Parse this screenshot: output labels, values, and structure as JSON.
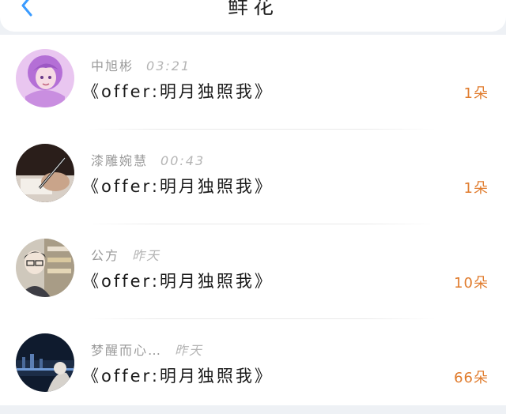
{
  "header": {
    "title": "鲜花",
    "back_icon": "chevron-left-icon",
    "accent_color": "#3a9bff"
  },
  "records": [
    {
      "name": "中旭彬",
      "time": "03:21",
      "gift": "《offer:明月独照我》",
      "count": "1朵",
      "avatar": "anime-girl-purple-hair"
    },
    {
      "name": "漆雕婉慧",
      "time": "00:43",
      "gift": "《offer:明月独照我》",
      "count": "1朵",
      "avatar": "hand-writing-with-pen"
    },
    {
      "name": "公方",
      "time": "昨天",
      "gift": "《offer:明月独照我》",
      "count": "10朵",
      "avatar": "anime-boy-in-store"
    },
    {
      "name": "梦醒而心…",
      "time": "昨天",
      "gift": "《offer:明月独照我》",
      "count": "66朵",
      "avatar": "night-city-skyline"
    }
  ],
  "colors": {
    "count_text": "#e07b2c",
    "meta_text": "#9a9a9a",
    "body_text": "#1a1a1a"
  }
}
